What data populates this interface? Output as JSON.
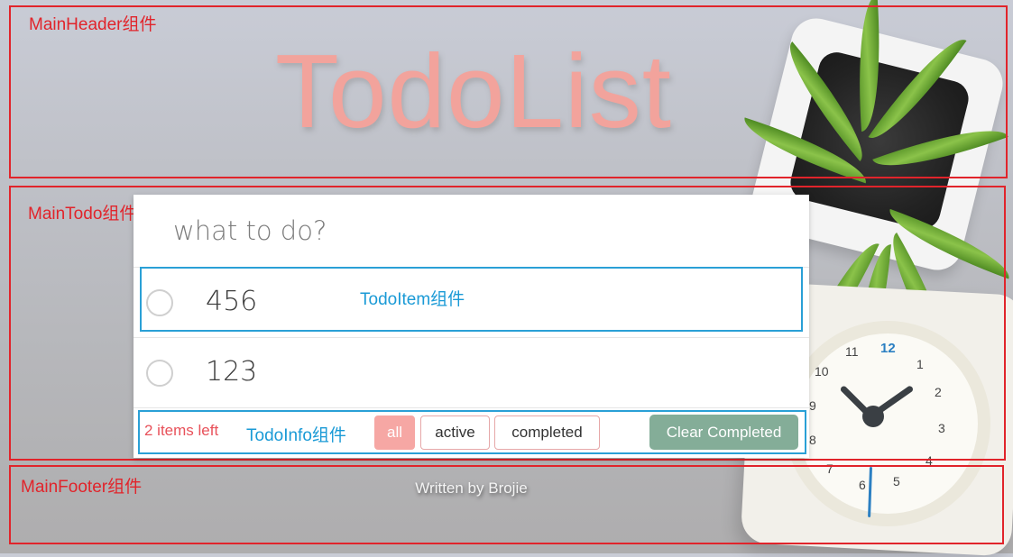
{
  "header": {
    "component_label": "MainHeader组件",
    "app_title": "TodoList"
  },
  "todo": {
    "component_label": "MainTodo组件",
    "input": {
      "placeholder": "what to do?",
      "value": ""
    },
    "items": [
      {
        "text": "456",
        "completed": false
      },
      {
        "text": "123",
        "completed": false
      }
    ],
    "item_component_label": "TodoItem组件"
  },
  "info": {
    "component_label": "TodoInfo组件",
    "items_left": "2 items left",
    "filters": [
      {
        "label": "all",
        "selected": true
      },
      {
        "label": "active",
        "selected": false
      },
      {
        "label": "completed",
        "selected": false
      }
    ],
    "clear_label": "Clear Completed"
  },
  "footer": {
    "component_label": "MainFooter组件",
    "credit": "Written by Brojie"
  },
  "background": {
    "clock_numbers": [
      "12",
      "1",
      "2",
      "3",
      "4",
      "5",
      "6",
      "7",
      "8",
      "9",
      "10",
      "11"
    ]
  },
  "colors": {
    "annotation_red": "#e1242b",
    "annotation_blue": "#2aa0d6",
    "title_pink": "#f2a39c",
    "filter_active": "#f6a7a4",
    "clear_button": "#84ad98",
    "items_left_red": "#e8515a"
  }
}
